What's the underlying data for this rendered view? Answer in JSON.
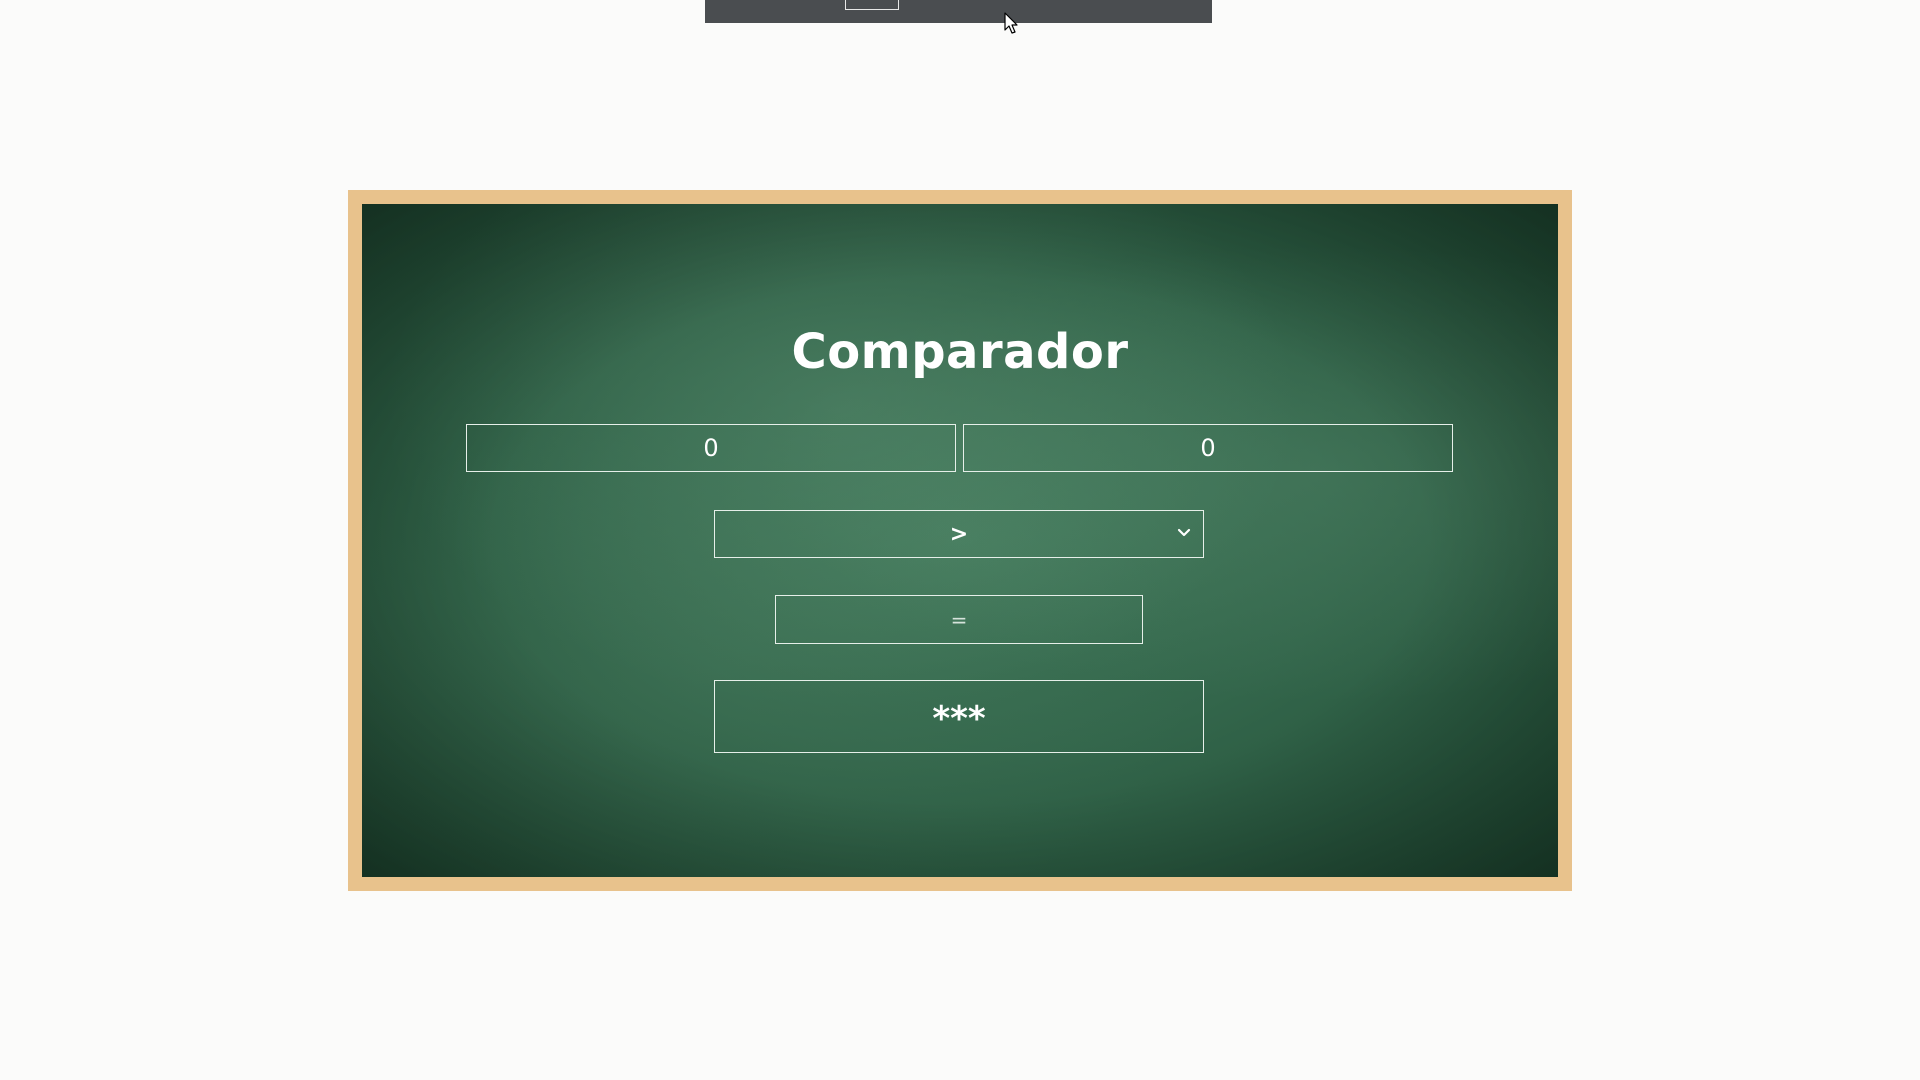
{
  "app": {
    "title": "Comparador"
  },
  "inputs": {
    "first_value": "0",
    "second_value": "0"
  },
  "operator_select": {
    "selected": ">",
    "icon": "chevron-down-icon"
  },
  "result": {
    "value": "="
  },
  "action": {
    "label": "***"
  },
  "colors": {
    "frame": "#e8c28c",
    "board": "#33664b",
    "text": "#ffffff"
  }
}
